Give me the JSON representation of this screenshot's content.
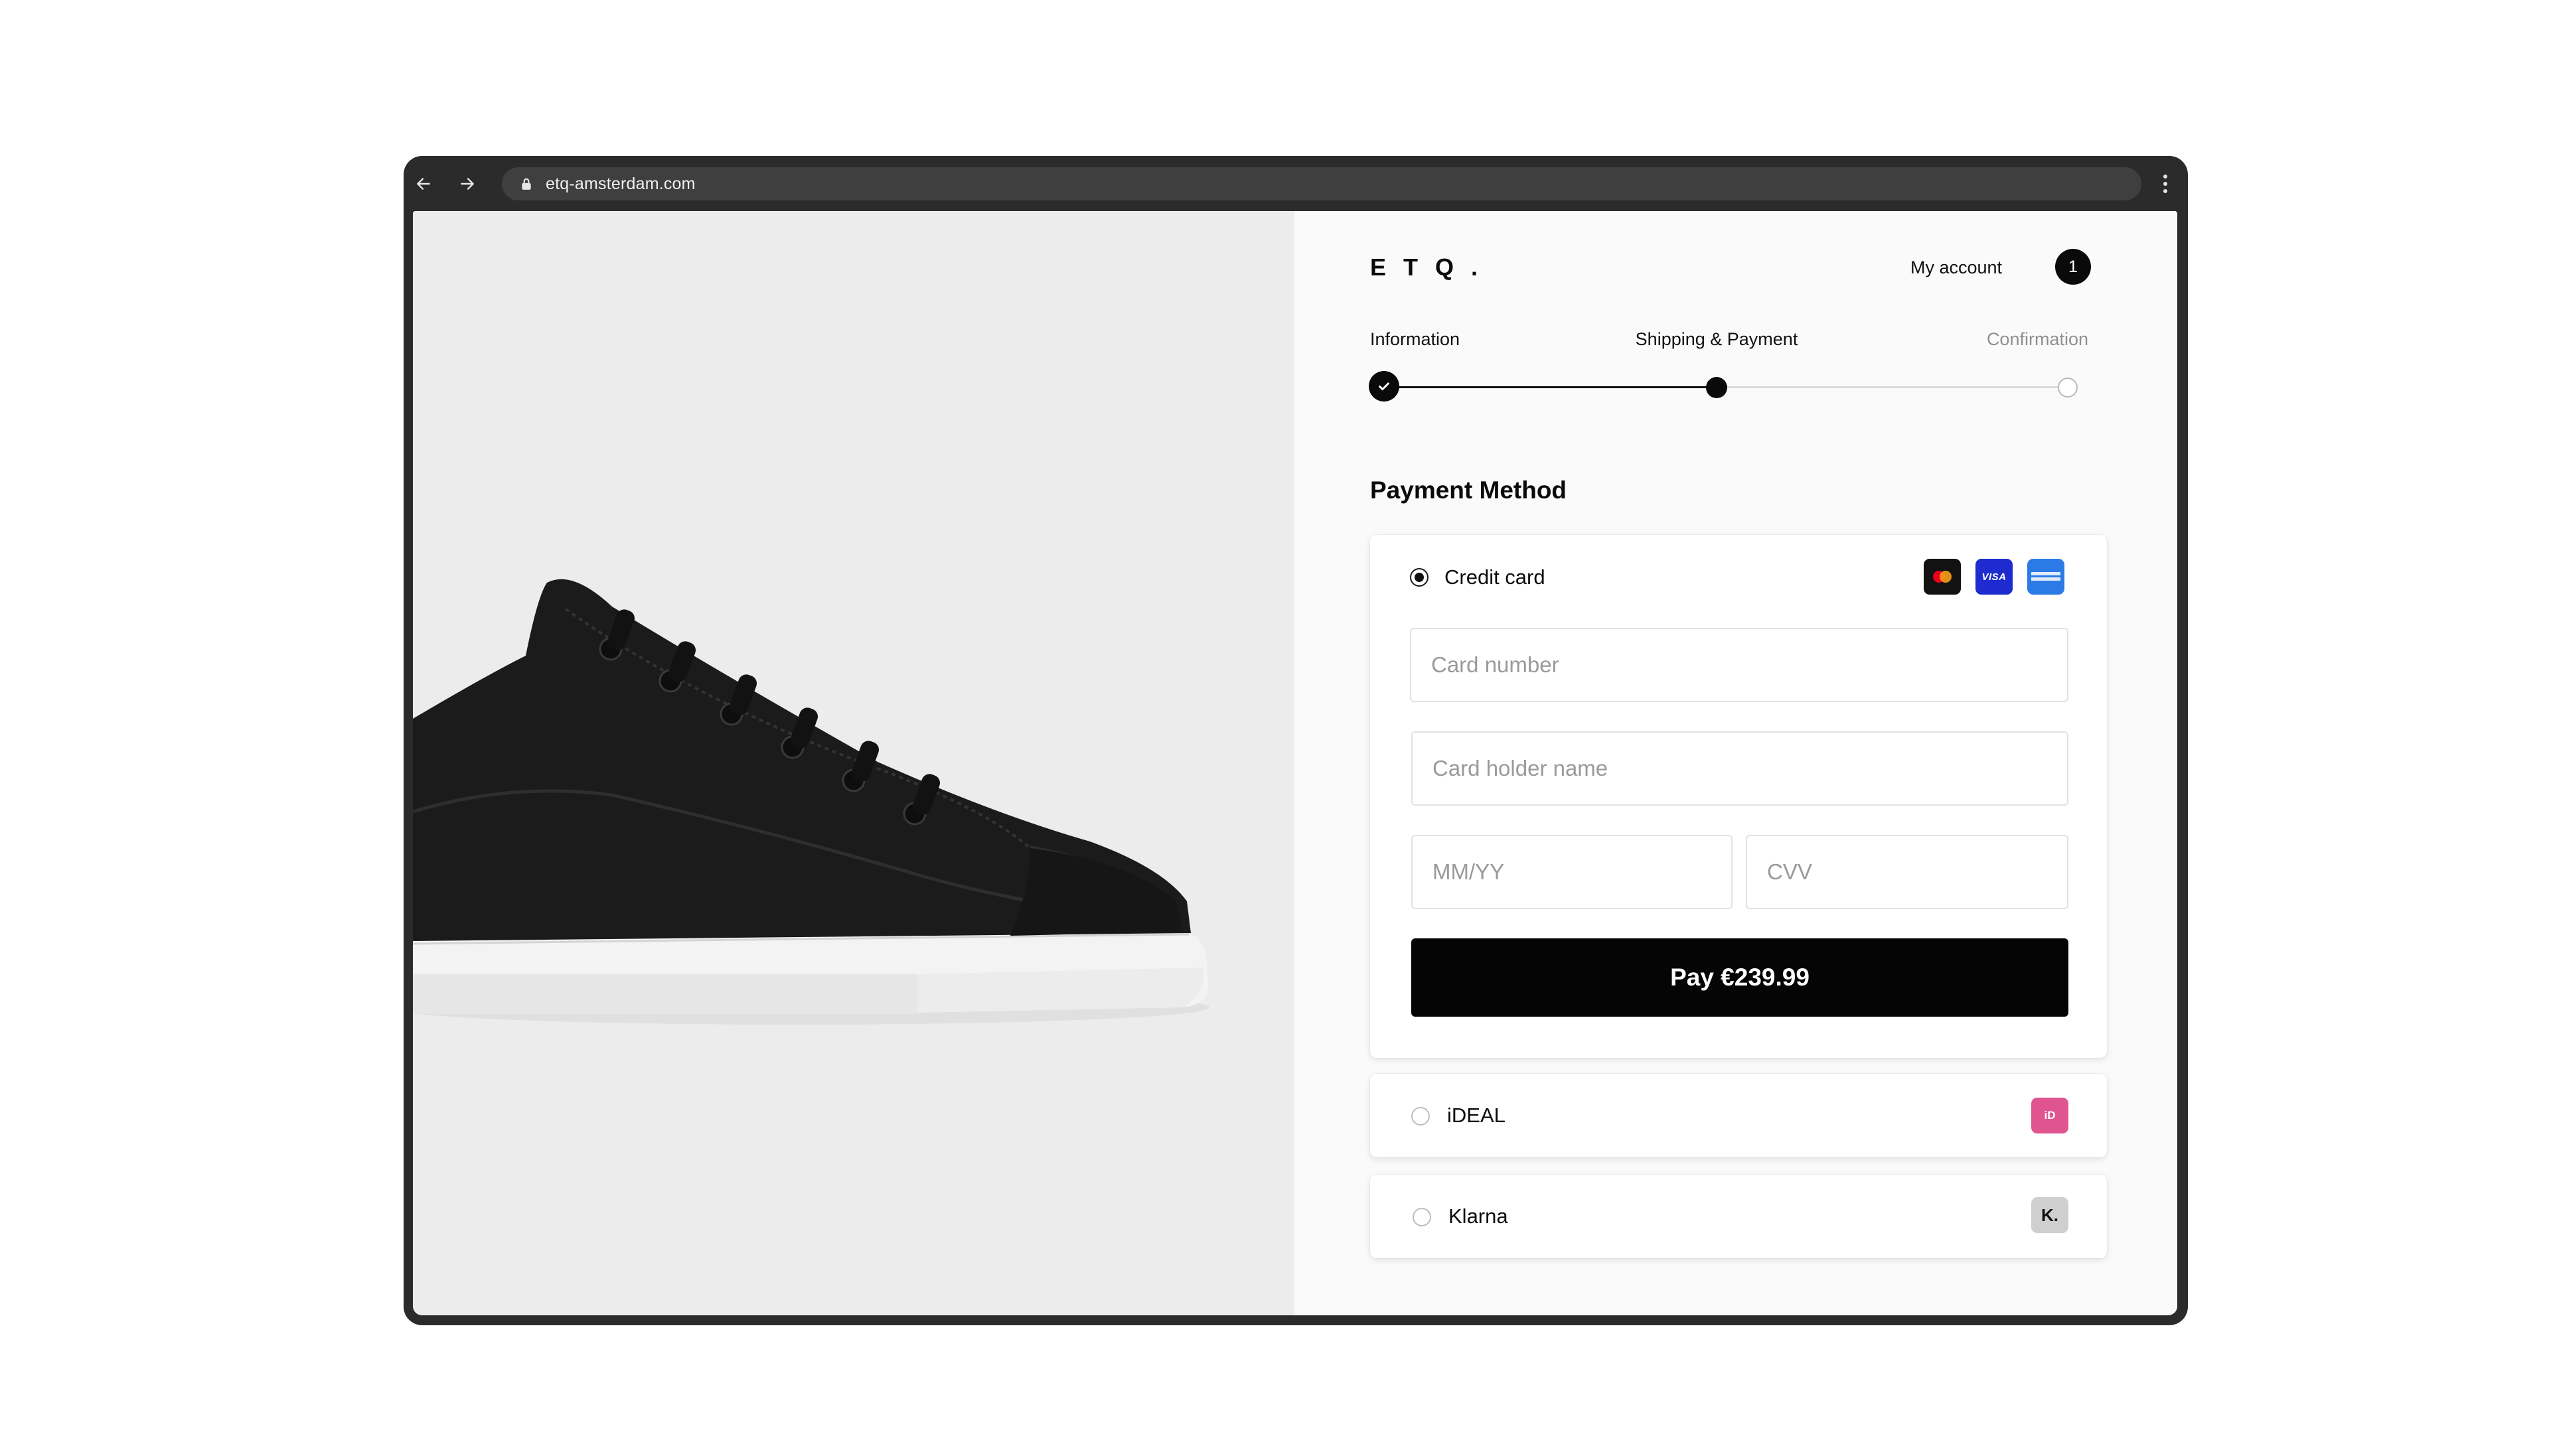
{
  "browser": {
    "url": "etq-amsterdam.com",
    "back_icon": "arrow-left-icon",
    "forward_icon": "arrow-right-icon",
    "lock_icon": "lock-icon",
    "menu_icon": "more-vertical-icon"
  },
  "product": {
    "image": "black-leather-sneaker",
    "colors": {
      "background": "#ececec",
      "upper": "#1a1a1a",
      "sole": "#f2f2f2"
    }
  },
  "header": {
    "logo": "ETQ.",
    "account_label": "My account",
    "cart_count": "1"
  },
  "steps": [
    {
      "label": "Information",
      "state": "done"
    },
    {
      "label": "Shipping & Payment",
      "state": "current"
    },
    {
      "label": "Confirmation",
      "state": "todo"
    }
  ],
  "payment": {
    "title": "Payment Method",
    "credit_card": {
      "label": "Credit card",
      "selected": true,
      "logos": [
        "Mastercard",
        "VISA",
        "AMERICAN EXPRESS"
      ],
      "card_number_placeholder": "Card number",
      "card_holder_placeholder": "Card holder name",
      "expiry_placeholder": "MM/YY",
      "cvv_placeholder": "CVV",
      "pay_label": "Pay €239.99"
    },
    "ideal": {
      "label": "iDEAL",
      "selected": false,
      "logo_text": "iD"
    },
    "klarna": {
      "label": "Klarna",
      "selected": false,
      "logo_text": "K."
    }
  },
  "colors": {
    "accent": "#050505",
    "visa": "#1d2bcf",
    "amex": "#2c7ae6",
    "ideal": "#e0548f",
    "klarna": "#cfcfcf"
  }
}
